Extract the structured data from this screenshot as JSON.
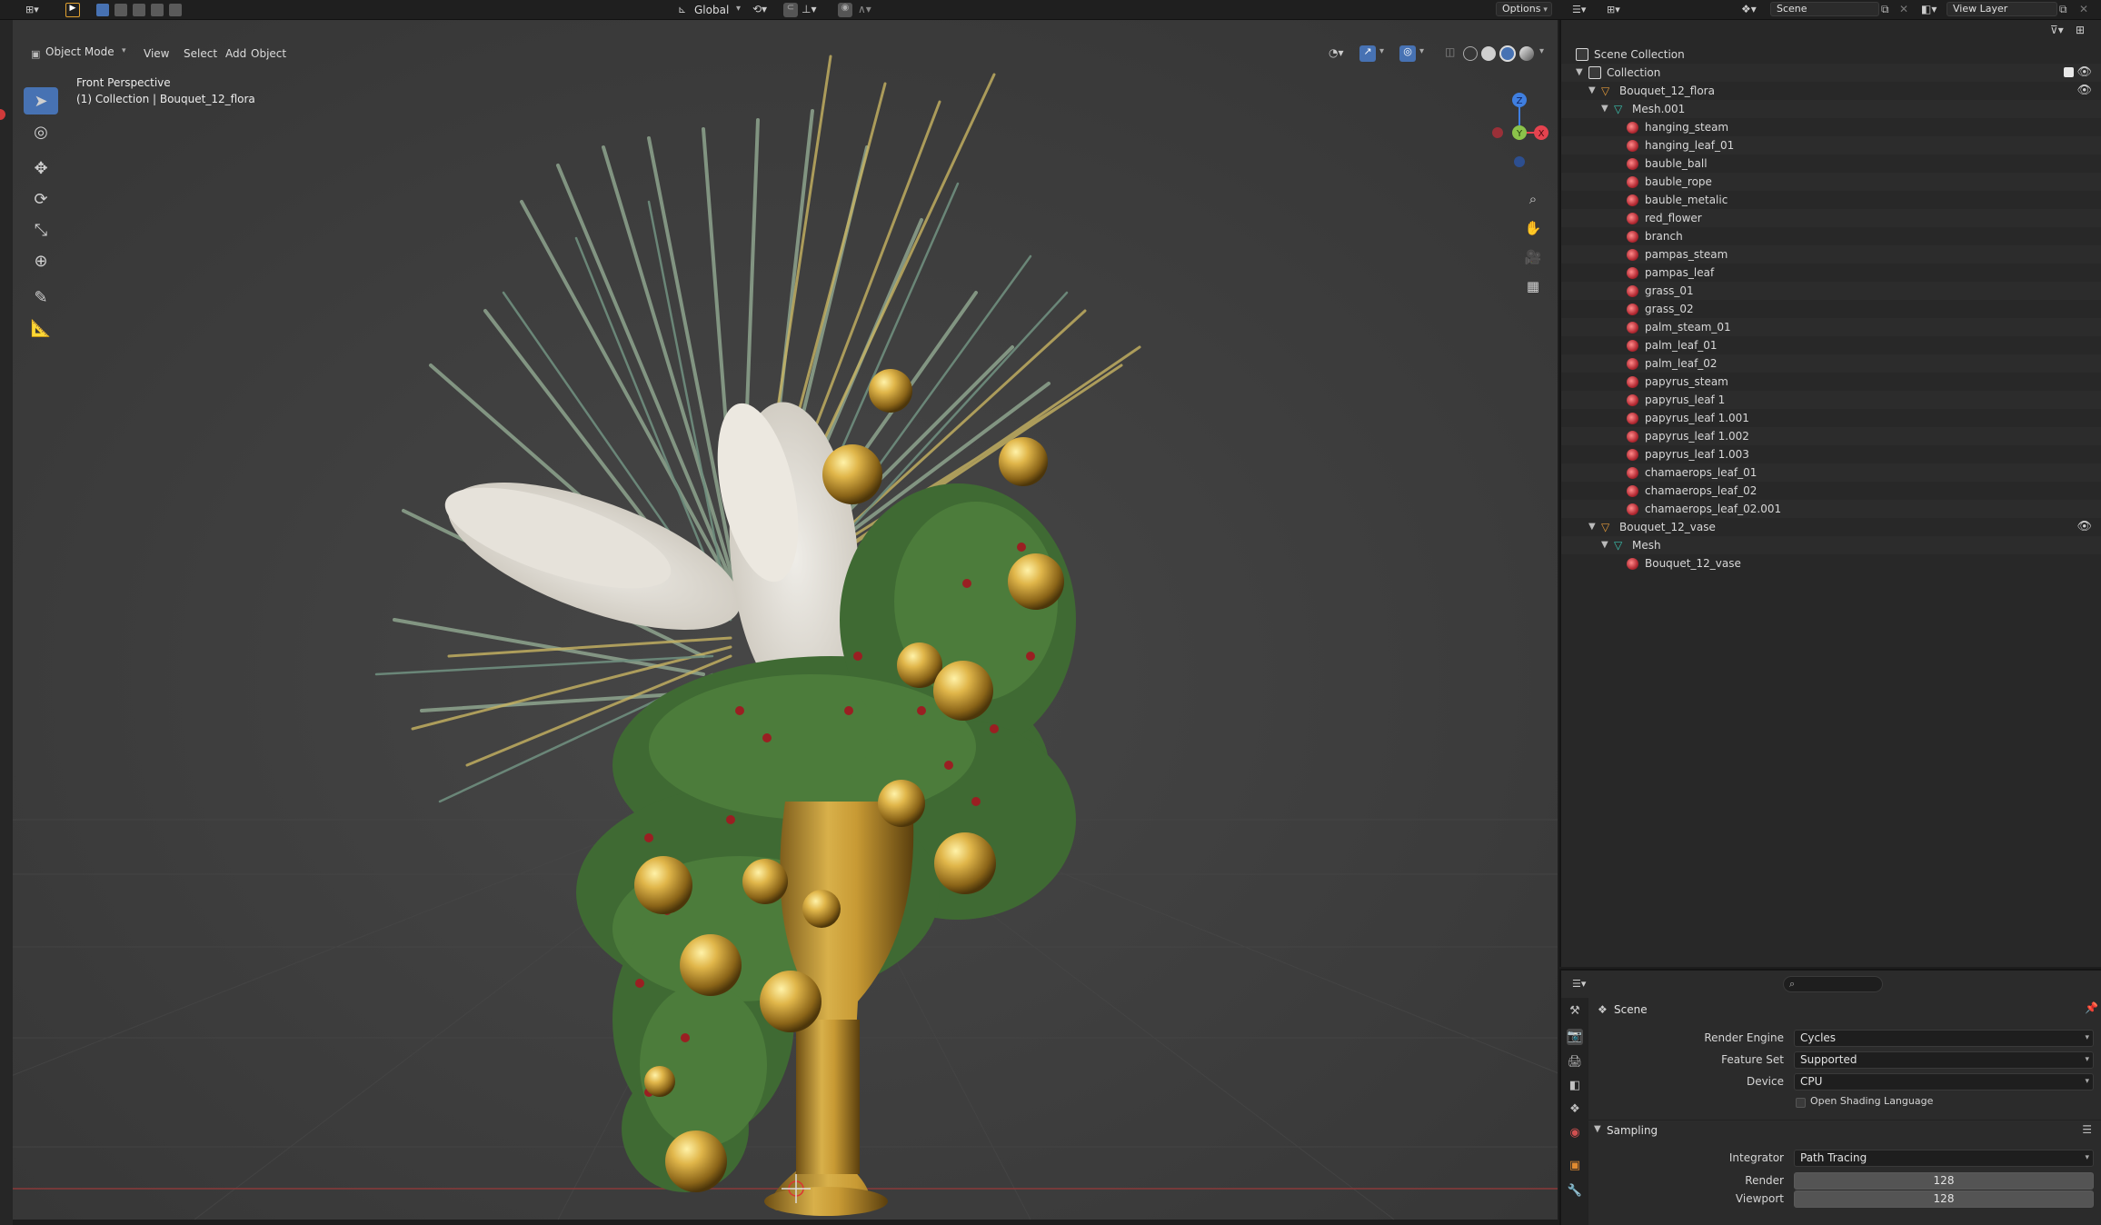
{
  "top_bar": {
    "scene_name": "Scene",
    "view_layer_name": "View Layer"
  },
  "viewport": {
    "mode": "Object Mode",
    "menus": [
      "View",
      "Select",
      "Add",
      "Object"
    ],
    "transform_orientation": "Global",
    "options_label": "Options",
    "overlay_title": "Front Perspective",
    "overlay_subtitle": "(1) Collection | Bouquet_12_flora",
    "tools": [
      "select-box",
      "cursor",
      "move",
      "rotate",
      "scale",
      "transform",
      "annotate",
      "measure"
    ],
    "gizmo_axes": [
      "X",
      "Y",
      "Z"
    ]
  },
  "outliner": {
    "rows": [
      {
        "label": "Scene Collection",
        "icon": "scene-collection-icon",
        "indent": 0,
        "arrow": ""
      },
      {
        "label": "Collection",
        "icon": "collection-icon",
        "indent": 1,
        "arrow": "▼"
      },
      {
        "label": "Bouquet_12_flora",
        "icon": "object-icon",
        "indent": 2,
        "arrow": "▼"
      },
      {
        "label": "Mesh.001",
        "icon": "mesh-icon",
        "indent": 3,
        "arrow": "▼"
      },
      {
        "label": "hanging_steam",
        "icon": "material-icon",
        "indent": 4
      },
      {
        "label": "hanging_leaf_01",
        "icon": "material-icon",
        "indent": 4
      },
      {
        "label": "bauble_ball",
        "icon": "material-icon",
        "indent": 4
      },
      {
        "label": "bauble_rope",
        "icon": "material-icon",
        "indent": 4
      },
      {
        "label": "bauble_metalic",
        "icon": "material-icon",
        "indent": 4
      },
      {
        "label": "red_flower",
        "icon": "material-icon",
        "indent": 4
      },
      {
        "label": "branch",
        "icon": "material-icon",
        "indent": 4
      },
      {
        "label": "pampas_steam",
        "icon": "material-icon",
        "indent": 4
      },
      {
        "label": "pampas_leaf",
        "icon": "material-icon",
        "indent": 4
      },
      {
        "label": "grass_01",
        "icon": "material-icon",
        "indent": 4
      },
      {
        "label": "grass_02",
        "icon": "material-icon",
        "indent": 4
      },
      {
        "label": "palm_steam_01",
        "icon": "material-icon",
        "indent": 4
      },
      {
        "label": "palm_leaf_01",
        "icon": "material-icon",
        "indent": 4
      },
      {
        "label": "palm_leaf_02",
        "icon": "material-icon",
        "indent": 4
      },
      {
        "label": "papyrus_steam",
        "icon": "material-icon",
        "indent": 4
      },
      {
        "label": "papyrus_leaf 1",
        "icon": "material-icon",
        "indent": 4
      },
      {
        "label": "papyrus_leaf 1.001",
        "icon": "material-icon",
        "indent": 4
      },
      {
        "label": "papyrus_leaf 1.002",
        "icon": "material-icon",
        "indent": 4
      },
      {
        "label": "papyrus_leaf 1.003",
        "icon": "material-icon",
        "indent": 4
      },
      {
        "label": "chamaerops_leaf_01",
        "icon": "material-icon",
        "indent": 4
      },
      {
        "label": "chamaerops_leaf_02",
        "icon": "material-icon",
        "indent": 4
      },
      {
        "label": "chamaerops_leaf_02.001",
        "icon": "material-icon",
        "indent": 4
      },
      {
        "label": "Bouquet_12_vase",
        "icon": "object-icon",
        "indent": 2,
        "arrow": "▼"
      },
      {
        "label": "Mesh",
        "icon": "mesh-icon",
        "indent": 3,
        "arrow": "▼"
      },
      {
        "label": "Bouquet_12_vase",
        "icon": "material-icon",
        "indent": 4
      }
    ]
  },
  "properties": {
    "context": "Scene",
    "render_engine_label": "Render Engine",
    "render_engine": "Cycles",
    "feature_set_label": "Feature Set",
    "feature_set": "Supported",
    "device_label": "Device",
    "device": "CPU",
    "osl_label": "Open Shading Language",
    "sampling_label": "Sampling",
    "integrator_label": "Integrator",
    "integrator": "Path Tracing",
    "render_label": "Render",
    "render_samples": "128",
    "viewport_label": "Viewport",
    "viewport_samples": "128"
  },
  "colors": {
    "accent": "#4772b3",
    "axis_x": "#e5434f",
    "axis_y": "#8bc34a",
    "axis_z": "#3f7fe0",
    "gold": "#c9a23a"
  }
}
